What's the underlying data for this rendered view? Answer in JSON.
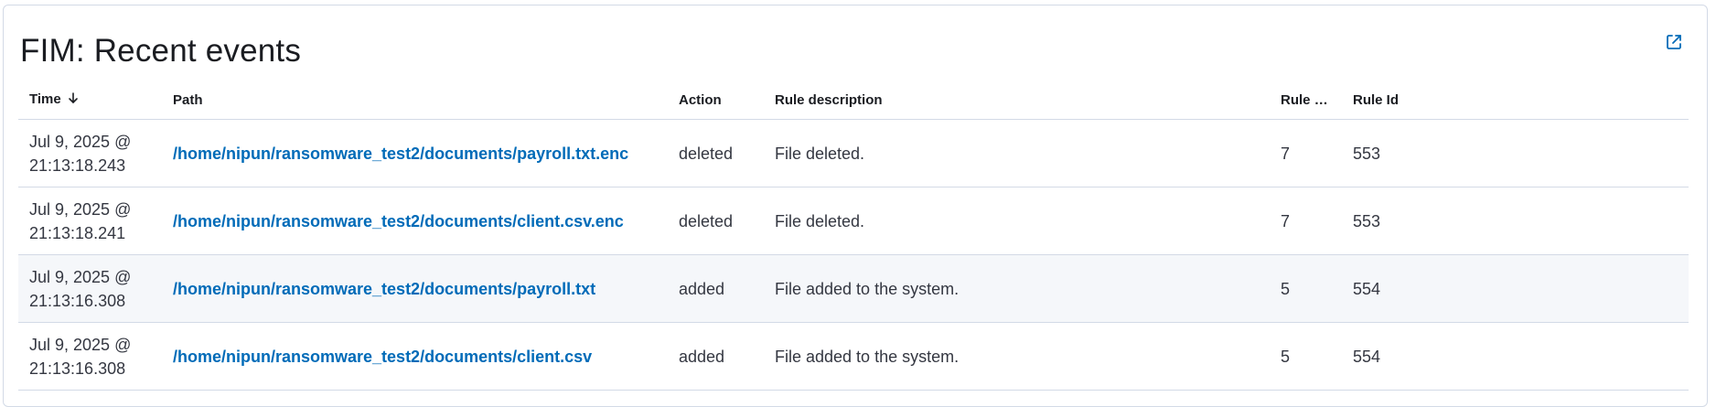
{
  "panel": {
    "title": "FIM: Recent events",
    "open_icon": "external-link-icon"
  },
  "table": {
    "columns": [
      {
        "key": "time",
        "label": "Time",
        "sorted": "desc"
      },
      {
        "key": "path",
        "label": "Path"
      },
      {
        "key": "action",
        "label": "Action"
      },
      {
        "key": "rule_description",
        "label": "Rule description"
      },
      {
        "key": "rule_level",
        "label": "Rule Lev..."
      },
      {
        "key": "rule_id",
        "label": "Rule Id"
      }
    ],
    "rows": [
      {
        "time_date": "Jul 9, 2025 @",
        "time_clock": "21:13:18.243",
        "path": "/home/nipun/ransomware_test2/documents/payroll.txt.enc",
        "action": "deleted",
        "rule_description": "File deleted.",
        "rule_level": "7",
        "rule_id": "553"
      },
      {
        "time_date": "Jul 9, 2025 @",
        "time_clock": "21:13:18.241",
        "path": "/home/nipun/ransomware_test2/documents/client.csv.enc",
        "action": "deleted",
        "rule_description": "File deleted.",
        "rule_level": "7",
        "rule_id": "553"
      },
      {
        "time_date": "Jul 9, 2025 @",
        "time_clock": "21:13:16.308",
        "path": "/home/nipun/ransomware_test2/documents/payroll.txt",
        "action": "added",
        "rule_description": "File added to the system.",
        "rule_level": "5",
        "rule_id": "554"
      },
      {
        "time_date": "Jul 9, 2025 @",
        "time_clock": "21:13:16.308",
        "path": "/home/nipun/ransomware_test2/documents/client.csv",
        "action": "added",
        "rule_description": "File added to the system.",
        "rule_level": "5",
        "rule_id": "554"
      }
    ]
  },
  "colors": {
    "link": "#006bb8",
    "border": "#d3dae6",
    "row_highlight": "#f5f7fa",
    "text": "#343741"
  }
}
